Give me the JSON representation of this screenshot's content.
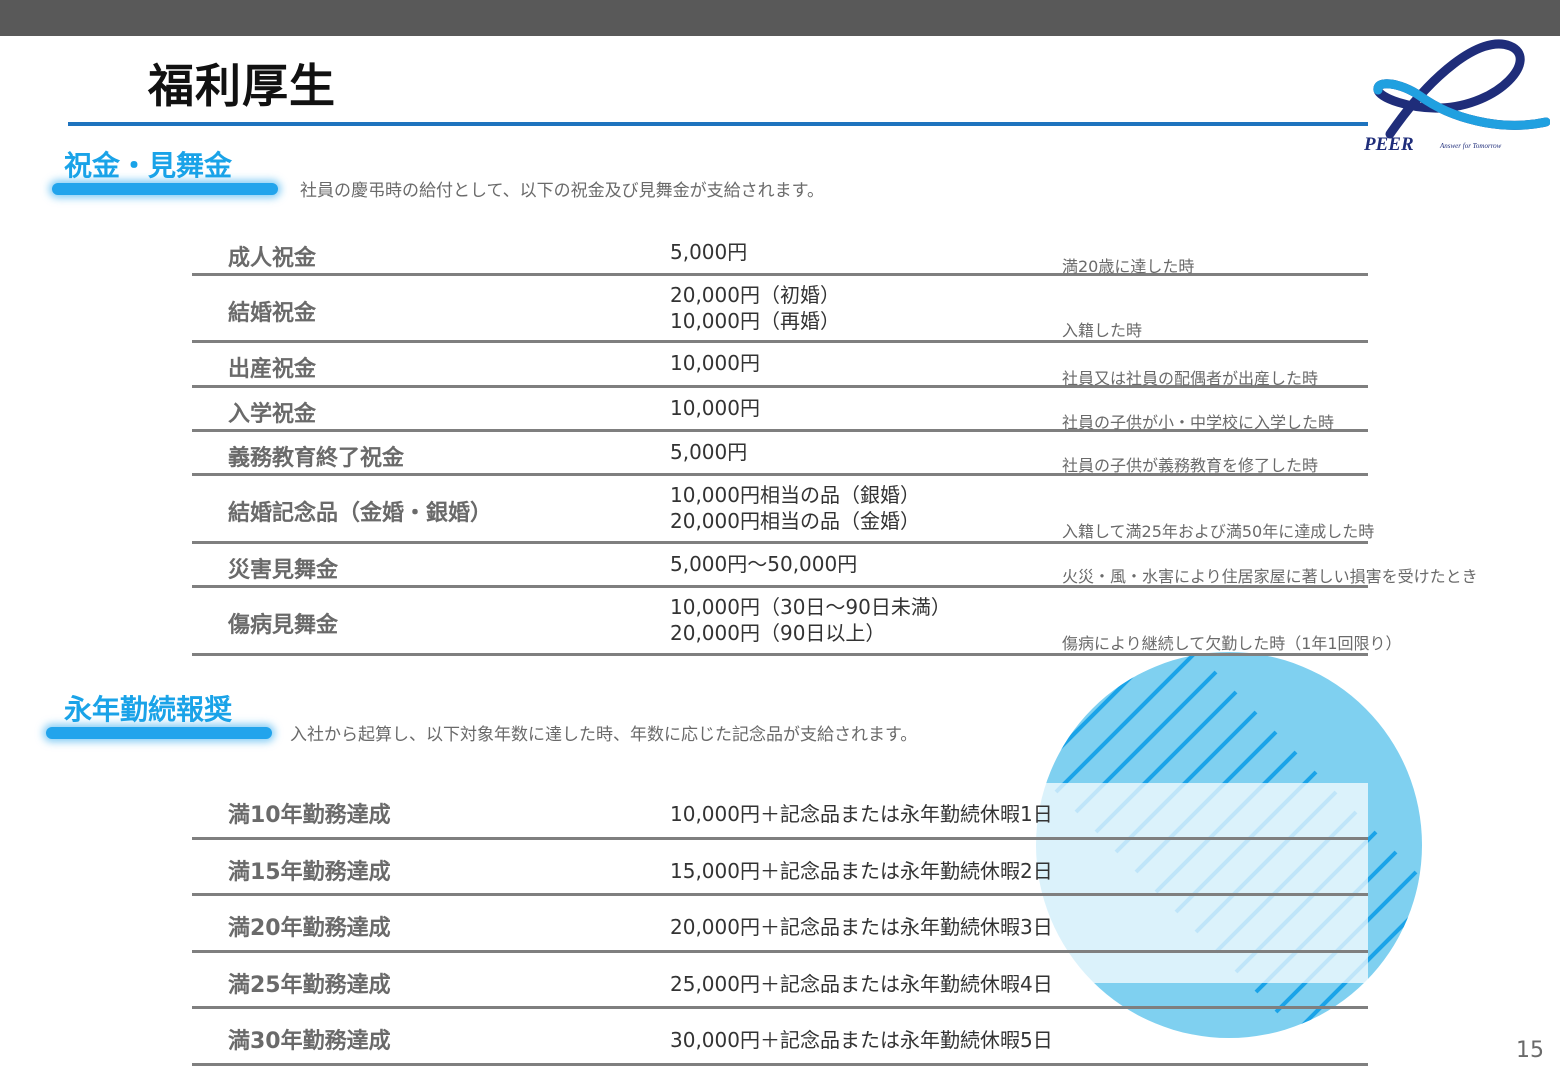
{
  "page": {
    "title": "福利厚生",
    "page_number": "15"
  },
  "logo": {
    "wordmark": "PEER",
    "tagline": "Answer for Tomorrow"
  },
  "colors": {
    "accent": "#1aa3e8",
    "rule": "#1e73be",
    "topbar": "#595959",
    "deco": "#7fd0f0"
  },
  "gifts": {
    "heading": "祝金・見舞金",
    "description": "社員の慶弔時の給付として、以下の祝金及び見舞金が支給されます。",
    "rows": [
      {
        "name": "成人祝金",
        "amount": "5,000円",
        "condition": "満20歳に達した時"
      },
      {
        "name": "結婚祝金",
        "amount": "20,000円（初婚）\n10,000円（再婚）",
        "condition": "入籍した時"
      },
      {
        "name": "出産祝金",
        "amount": "10,000円",
        "condition": "社員又は社員の配偶者が出産した時"
      },
      {
        "name": "入学祝金",
        "amount": "10,000円",
        "condition": "社員の子供が小・中学校に入学した時"
      },
      {
        "name": "義務教育終了祝金",
        "amount": "5,000円",
        "condition": "社員の子供が義務教育を修了した時"
      },
      {
        "name": "結婚記念品（金婚・銀婚）",
        "amount": "10,000円相当の品（銀婚）\n20,000円相当の品（金婚）",
        "condition": "入籍して満25年および満50年に達成した時"
      },
      {
        "name": "災害見舞金",
        "amount": "5,000円～50,000円",
        "condition": "火災・風・水害により住居家屋に著しい損害を受けたとき"
      },
      {
        "name": "傷病見舞金",
        "amount": "10,000円（30日～90日未満）\n20,000円（90日以上）",
        "condition": "傷病により継続して欠勤した時（1年1回限り）"
      }
    ]
  },
  "awards": {
    "heading": "永年勤続報奨",
    "description": "入社から起算し、以下対象年数に達した時、年数に応じた記念品が支給されます。",
    "rows": [
      {
        "name": "満10年勤務達成",
        "amount": "10,000円＋記念品または永年勤続休暇1日"
      },
      {
        "name": "満15年勤務達成",
        "amount": "15,000円＋記念品または永年勤続休暇2日"
      },
      {
        "name": "満20年勤務達成",
        "amount": "20,000円＋記念品または永年勤続休暇3日"
      },
      {
        "name": "満25年勤務達成",
        "amount": "25,000円＋記念品または永年勤続休暇4日"
      },
      {
        "name": "満30年勤務達成",
        "amount": "30,000円＋記念品または永年勤続休暇5日"
      }
    ]
  }
}
